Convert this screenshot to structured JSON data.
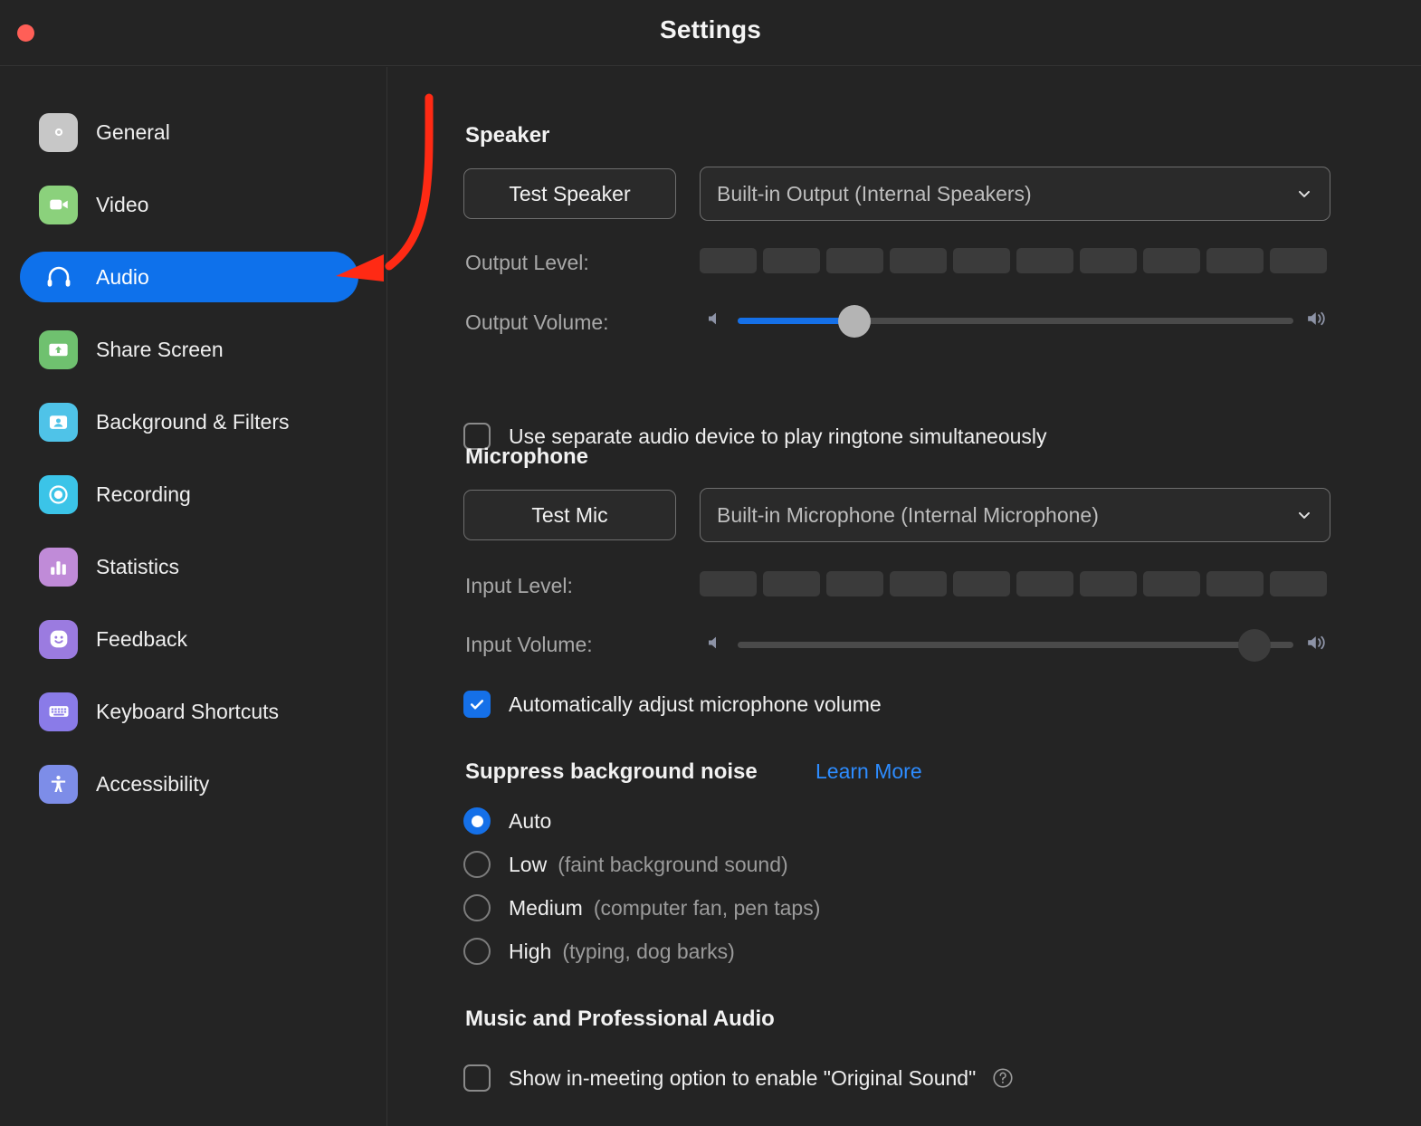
{
  "window": {
    "title": "Settings",
    "close_button": "close",
    "accent_color": "#0E71EB",
    "link_color": "#2D8CFF",
    "annotation_color": "#FF2A14"
  },
  "sidebar": {
    "items": [
      {
        "label": "General",
        "icon": "gear-icon",
        "icon_color": "#C7C7C7",
        "selected": false
      },
      {
        "label": "Video",
        "icon": "video-camera-icon",
        "icon_color": "#8BD17C",
        "selected": false
      },
      {
        "label": "Audio",
        "icon": "headphones-icon",
        "icon_color": "#0E71EB",
        "selected": true
      },
      {
        "label": "Share Screen",
        "icon": "share-screen-icon",
        "icon_color": "#6FC16F",
        "selected": false
      },
      {
        "label": "Background & Filters",
        "icon": "person-frame-icon",
        "icon_color": "#4FC3E8",
        "selected": false
      },
      {
        "label": "Recording",
        "icon": "record-circle-icon",
        "icon_color": "#3BC4E8",
        "selected": false
      },
      {
        "label": "Statistics",
        "icon": "bar-chart-icon",
        "icon_color": "#C08BD8",
        "selected": false
      },
      {
        "label": "Feedback",
        "icon": "smiley-face-icon",
        "icon_color": "#9B7BE0",
        "selected": false
      },
      {
        "label": "Keyboard Shortcuts",
        "icon": "keyboard-icon",
        "icon_color": "#8A7BE8",
        "selected": false
      },
      {
        "label": "Accessibility",
        "icon": "accessibility-icon",
        "icon_color": "#7D8DE8",
        "selected": false
      }
    ]
  },
  "speaker": {
    "heading": "Speaker",
    "test_button": "Test Speaker",
    "device": "Built-in Output (Internal Speakers)",
    "output_level_label": "Output Level:",
    "output_level_segments": 10,
    "output_level_active": 0,
    "output_volume_label": "Output Volume:",
    "output_volume_percent": 21,
    "ringtone_checkbox": {
      "label": "Use separate audio device to play ringtone simultaneously",
      "checked": false
    }
  },
  "microphone": {
    "heading": "Microphone",
    "test_button": "Test Mic",
    "device": "Built-in Microphone (Internal Microphone)",
    "input_level_label": "Input Level:",
    "input_level_segments": 10,
    "input_level_active": 0,
    "input_volume_label": "Input Volume:",
    "input_volume_percent": 93,
    "auto_adjust_checkbox": {
      "label": "Automatically adjust microphone volume",
      "checked": true
    }
  },
  "suppress_noise": {
    "heading": "Suppress background noise",
    "learn_more": "Learn More",
    "options": [
      {
        "label": "Auto",
        "hint": "",
        "selected": true
      },
      {
        "label": "Low",
        "hint": "(faint background sound)",
        "selected": false
      },
      {
        "label": "Medium",
        "hint": "(computer fan, pen taps)",
        "selected": false
      },
      {
        "label": "High",
        "hint": "(typing, dog barks)",
        "selected": false
      }
    ]
  },
  "music_audio": {
    "heading": "Music and Professional Audio",
    "original_sound_checkbox": {
      "label": "Show in-meeting option to enable \"Original Sound\"",
      "checked": false
    },
    "help_icon": "question-mark-circle-icon"
  }
}
